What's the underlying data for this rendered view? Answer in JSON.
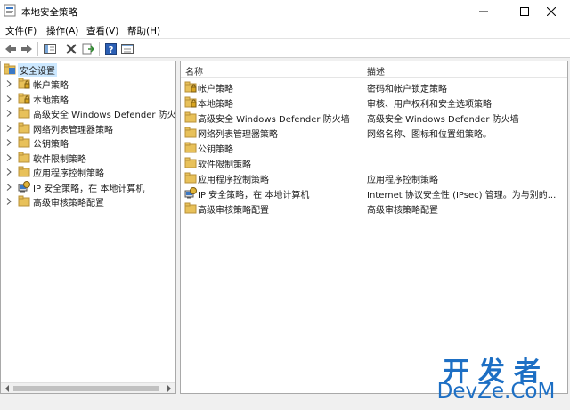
{
  "window": {
    "title": "本地安全策略",
    "controls": {
      "minimize": "—",
      "maximize": "☐",
      "close": "✕"
    }
  },
  "menu": [
    "文件(F)",
    "操作(A)",
    "查看(V)",
    "帮助(H)"
  ],
  "toolbar": [
    "back-icon",
    "forward-icon",
    "show-hide-tree-icon",
    "delete-icon",
    "export-list-icon",
    "help-icon",
    "properties-icon"
  ],
  "tree": {
    "root": "安全设置",
    "items": [
      {
        "label": "帐户策略",
        "icon": "folder-lock-icon"
      },
      {
        "label": "本地策略",
        "icon": "folder-lock-icon"
      },
      {
        "label": "高级安全 Windows Defender 防火墙",
        "icon": "folder-icon"
      },
      {
        "label": "网络列表管理器策略",
        "icon": "folder-icon"
      },
      {
        "label": "公钥策略",
        "icon": "folder-icon"
      },
      {
        "label": "软件限制策略",
        "icon": "folder-icon"
      },
      {
        "label": "应用程序控制策略",
        "icon": "folder-icon"
      },
      {
        "label": "IP 安全策略，在 本地计算机",
        "icon": "ipsec-icon"
      },
      {
        "label": "高级审核策略配置",
        "icon": "folder-icon"
      }
    ]
  },
  "list": {
    "columns": {
      "name": "名称",
      "description": "描述"
    },
    "rows": [
      {
        "name": "帐户策略",
        "description": "密码和帐户锁定策略",
        "icon": "folder-lock-icon"
      },
      {
        "name": "本地策略",
        "description": "审核、用户权利和安全选项策略",
        "icon": "folder-lock-icon"
      },
      {
        "name": "高级安全 Windows Defender 防火墙",
        "description": "高级安全 Windows Defender 防火墙",
        "icon": "folder-icon"
      },
      {
        "name": "网络列表管理器策略",
        "description": "网络名称、图标和位置组策略。",
        "icon": "folder-icon"
      },
      {
        "name": "公钥策略",
        "description": "",
        "icon": "folder-icon"
      },
      {
        "name": "软件限制策略",
        "description": "",
        "icon": "folder-icon"
      },
      {
        "name": "应用程序控制策略",
        "description": "应用程序控制策略",
        "icon": "folder-icon"
      },
      {
        "name": "IP 安全策略，在 本地计算机",
        "description": "Internet 协议安全性 (IPsec) 管理。为与别的...",
        "icon": "ipsec-icon"
      },
      {
        "name": "高级审核策略配置",
        "description": "高级审核策略配置",
        "icon": "folder-icon"
      }
    ]
  },
  "watermark": {
    "cn": "开发者",
    "en": "DevZe.CoM"
  },
  "colors": {
    "folder": "#e8c15a",
    "selection": "#cce8ff",
    "watermark": "#1d6fc4"
  }
}
